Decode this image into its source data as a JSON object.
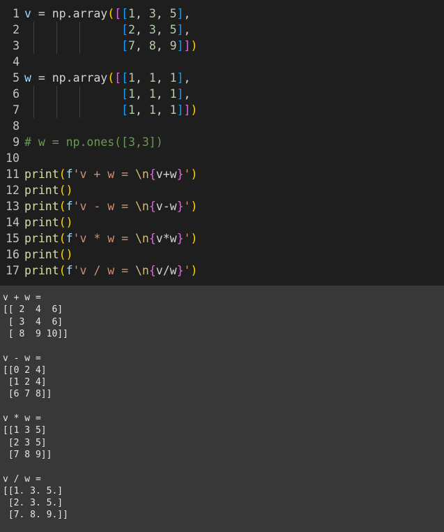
{
  "colors": {
    "editor_bg": "#1e1e1e",
    "output_bg": "#383838",
    "line_number": "#c6c6c6",
    "variable": "#9cdcfe",
    "identifier": "#d4d4d4",
    "function": "#dcdcaa",
    "number": "#b5cea8",
    "string": "#ce9178",
    "escape": "#d7ba7d",
    "comment": "#6a9955",
    "bracket_1": "#ffd700",
    "bracket_2": "#da70d6",
    "bracket_3": "#179fff",
    "output_text": "#e6e6e6"
  },
  "editor": {
    "lines": [
      {
        "num": "1",
        "tokens": [
          {
            "t": "v",
            "c": "variable"
          },
          {
            "t": " = ",
            "c": "identifier"
          },
          {
            "t": "np",
            "c": "identifier"
          },
          {
            "t": ".",
            "c": "identifier"
          },
          {
            "t": "array",
            "c": "identifier"
          },
          {
            "t": "(",
            "c": "bracket_1"
          },
          {
            "t": "[",
            "c": "bracket_2"
          },
          {
            "t": "[",
            "c": "bracket_3"
          },
          {
            "t": "1",
            "c": "number"
          },
          {
            "t": ", ",
            "c": "identifier"
          },
          {
            "t": "3",
            "c": "number"
          },
          {
            "t": ", ",
            "c": "identifier"
          },
          {
            "t": "5",
            "c": "number"
          },
          {
            "t": "]",
            "c": "bracket_3"
          },
          {
            "t": ",",
            "c": "identifier"
          }
        ]
      },
      {
        "num": "2",
        "tokens": [
          {
            "t": "              ",
            "c": "identifier"
          },
          {
            "t": "[",
            "c": "bracket_3"
          },
          {
            "t": "2",
            "c": "number"
          },
          {
            "t": ", ",
            "c": "identifier"
          },
          {
            "t": "3",
            "c": "number"
          },
          {
            "t": ", ",
            "c": "identifier"
          },
          {
            "t": "5",
            "c": "number"
          },
          {
            "t": "]",
            "c": "bracket_3"
          },
          {
            "t": ",",
            "c": "identifier"
          }
        ]
      },
      {
        "num": "3",
        "tokens": [
          {
            "t": "              ",
            "c": "identifier"
          },
          {
            "t": "[",
            "c": "bracket_3"
          },
          {
            "t": "7",
            "c": "number"
          },
          {
            "t": ", ",
            "c": "identifier"
          },
          {
            "t": "8",
            "c": "number"
          },
          {
            "t": ", ",
            "c": "identifier"
          },
          {
            "t": "9",
            "c": "number"
          },
          {
            "t": "]",
            "c": "bracket_3"
          },
          {
            "t": "]",
            "c": "bracket_2"
          },
          {
            "t": ")",
            "c": "bracket_1"
          }
        ]
      },
      {
        "num": "4",
        "tokens": []
      },
      {
        "num": "5",
        "tokens": [
          {
            "t": "w",
            "c": "variable"
          },
          {
            "t": " = ",
            "c": "identifier"
          },
          {
            "t": "np",
            "c": "identifier"
          },
          {
            "t": ".",
            "c": "identifier"
          },
          {
            "t": "array",
            "c": "identifier"
          },
          {
            "t": "(",
            "c": "bracket_1"
          },
          {
            "t": "[",
            "c": "bracket_2"
          },
          {
            "t": "[",
            "c": "bracket_3"
          },
          {
            "t": "1",
            "c": "number"
          },
          {
            "t": ", ",
            "c": "identifier"
          },
          {
            "t": "1",
            "c": "number"
          },
          {
            "t": ", ",
            "c": "identifier"
          },
          {
            "t": "1",
            "c": "number"
          },
          {
            "t": "]",
            "c": "bracket_3"
          },
          {
            "t": ",",
            "c": "identifier"
          }
        ]
      },
      {
        "num": "6",
        "tokens": [
          {
            "t": "              ",
            "c": "identifier"
          },
          {
            "t": "[",
            "c": "bracket_3"
          },
          {
            "t": "1",
            "c": "number"
          },
          {
            "t": ", ",
            "c": "identifier"
          },
          {
            "t": "1",
            "c": "number"
          },
          {
            "t": ", ",
            "c": "identifier"
          },
          {
            "t": "1",
            "c": "number"
          },
          {
            "t": "]",
            "c": "bracket_3"
          },
          {
            "t": ",",
            "c": "identifier"
          }
        ]
      },
      {
        "num": "7",
        "tokens": [
          {
            "t": "              ",
            "c": "identifier"
          },
          {
            "t": "[",
            "c": "bracket_3"
          },
          {
            "t": "1",
            "c": "number"
          },
          {
            "t": ", ",
            "c": "identifier"
          },
          {
            "t": "1",
            "c": "number"
          },
          {
            "t": ", ",
            "c": "identifier"
          },
          {
            "t": "1",
            "c": "number"
          },
          {
            "t": "]",
            "c": "bracket_3"
          },
          {
            "t": "]",
            "c": "bracket_2"
          },
          {
            "t": ")",
            "c": "bracket_1"
          }
        ]
      },
      {
        "num": "8",
        "tokens": []
      },
      {
        "num": "9",
        "tokens": [
          {
            "t": "# w = np.ones([3,3])",
            "c": "comment"
          }
        ]
      },
      {
        "num": "10",
        "tokens": []
      },
      {
        "num": "11",
        "tokens": [
          {
            "t": "print",
            "c": "function"
          },
          {
            "t": "(",
            "c": "bracket_1"
          },
          {
            "t": "f",
            "c": "variable"
          },
          {
            "t": "'v + w = ",
            "c": "string"
          },
          {
            "t": "\\n",
            "c": "escape"
          },
          {
            "t": "{",
            "c": "bracket_2"
          },
          {
            "t": "v+w",
            "c": "identifier"
          },
          {
            "t": "}",
            "c": "bracket_2"
          },
          {
            "t": "'",
            "c": "string"
          },
          {
            "t": ")",
            "c": "bracket_1"
          }
        ]
      },
      {
        "num": "12",
        "tokens": [
          {
            "t": "print",
            "c": "function"
          },
          {
            "t": "(",
            "c": "bracket_1"
          },
          {
            "t": ")",
            "c": "bracket_1"
          }
        ]
      },
      {
        "num": "13",
        "tokens": [
          {
            "t": "print",
            "c": "function"
          },
          {
            "t": "(",
            "c": "bracket_1"
          },
          {
            "t": "f",
            "c": "variable"
          },
          {
            "t": "'v - w = ",
            "c": "string"
          },
          {
            "t": "\\n",
            "c": "escape"
          },
          {
            "t": "{",
            "c": "bracket_2"
          },
          {
            "t": "v-w",
            "c": "identifier"
          },
          {
            "t": "}",
            "c": "bracket_2"
          },
          {
            "t": "'",
            "c": "string"
          },
          {
            "t": ")",
            "c": "bracket_1"
          }
        ]
      },
      {
        "num": "14",
        "tokens": [
          {
            "t": "print",
            "c": "function"
          },
          {
            "t": "(",
            "c": "bracket_1"
          },
          {
            "t": ")",
            "c": "bracket_1"
          }
        ]
      },
      {
        "num": "15",
        "tokens": [
          {
            "t": "print",
            "c": "function"
          },
          {
            "t": "(",
            "c": "bracket_1"
          },
          {
            "t": "f",
            "c": "variable"
          },
          {
            "t": "'v * w = ",
            "c": "string"
          },
          {
            "t": "\\n",
            "c": "escape"
          },
          {
            "t": "{",
            "c": "bracket_2"
          },
          {
            "t": "v*w",
            "c": "identifier"
          },
          {
            "t": "}",
            "c": "bracket_2"
          },
          {
            "t": "'",
            "c": "string"
          },
          {
            "t": ")",
            "c": "bracket_1"
          }
        ]
      },
      {
        "num": "16",
        "tokens": [
          {
            "t": "print",
            "c": "function"
          },
          {
            "t": "(",
            "c": "bracket_1"
          },
          {
            "t": ")",
            "c": "bracket_1"
          }
        ]
      },
      {
        "num": "17",
        "tokens": [
          {
            "t": "print",
            "c": "function"
          },
          {
            "t": "(",
            "c": "bracket_1"
          },
          {
            "t": "f",
            "c": "variable"
          },
          {
            "t": "'v / w = ",
            "c": "string"
          },
          {
            "t": "\\n",
            "c": "escape"
          },
          {
            "t": "{",
            "c": "bracket_2"
          },
          {
            "t": "v/w",
            "c": "identifier"
          },
          {
            "t": "}",
            "c": "bracket_2"
          },
          {
            "t": "'",
            "c": "string"
          },
          {
            "t": ")",
            "c": "bracket_1"
          }
        ]
      }
    ]
  },
  "output": {
    "lines": [
      "v + w =",
      "[[ 2  4  6]",
      " [ 3  4  6]",
      " [ 8  9 10]]",
      "",
      "v - w =",
      "[[0 2 4]",
      " [1 2 4]",
      " [6 7 8]]",
      "",
      "v * w =",
      "[[1 3 5]",
      " [2 3 5]",
      " [7 8 9]]",
      "",
      "v / w =",
      "[[1. 3. 5.]",
      " [2. 3. 5.]",
      " [7. 8. 9.]]"
    ]
  }
}
